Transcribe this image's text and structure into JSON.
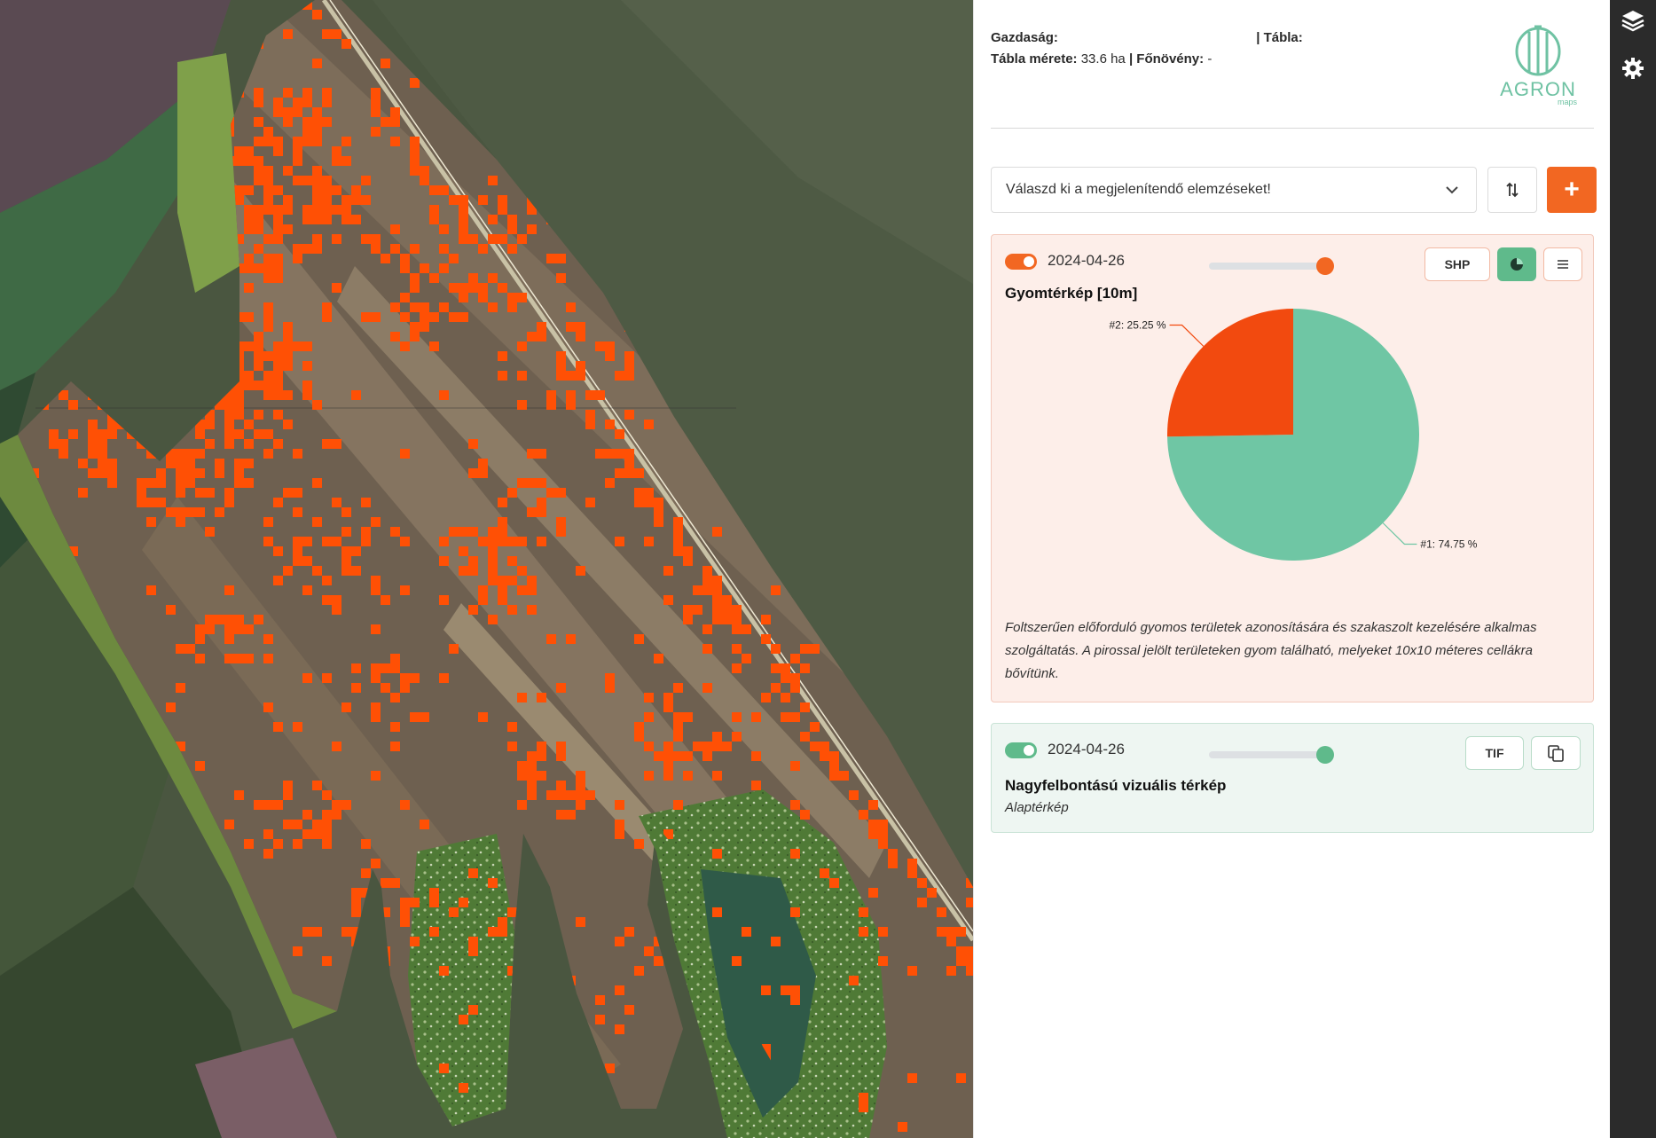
{
  "header": {
    "farm_label": "Gazdaság:",
    "farm_value": "",
    "table_label": "| Tábla:",
    "table_value": "",
    "size_label": "Tábla mérete:",
    "size_value": "33.6 ha",
    "crop_label": "| Főnövény:",
    "crop_value": "-"
  },
  "logo": {
    "name": "AGRON",
    "sub": "maps"
  },
  "toolbar": {
    "select_placeholder": "Válaszd ki a megjelenítendő elemzéseket!",
    "sort_icon": "sort-icon",
    "add_label": "+"
  },
  "weed_card": {
    "enabled": true,
    "date": "2024-04-26",
    "opacity": 1.0,
    "shp_label": "SHP",
    "title": "Gyomtérkép [10m]",
    "description": "Foltszerűen előforduló gyomos területek azonosítására és szakaszolt kezelésére alkalmas szolgáltatás. A pirossal jelölt területeken gyom található, melyeket 10x10 méteres cellákra bővítünk."
  },
  "visual_card": {
    "enabled": true,
    "date": "2024-04-26",
    "opacity": 1.0,
    "tif_label": "TIF",
    "title": "Nagyfelbontású vizuális térkép",
    "subtitle": "Alaptérkép"
  },
  "chart_data": {
    "type": "pie",
    "slices": [
      {
        "label": "#1: 74.75 %",
        "value": 74.75,
        "color": "#6fc6a4"
      },
      {
        "label": "#2: 25.25 %",
        "value": 25.25,
        "color": "#f24a0f"
      }
    ]
  },
  "colors": {
    "accent": "#f26722",
    "weed": "#f24a0f",
    "green": "#6fc6a4",
    "weed_card_bg": "#fdeee9",
    "visual_card_bg": "#eef6f2"
  },
  "tools": [
    "layers-icon",
    "settings-icon"
  ]
}
